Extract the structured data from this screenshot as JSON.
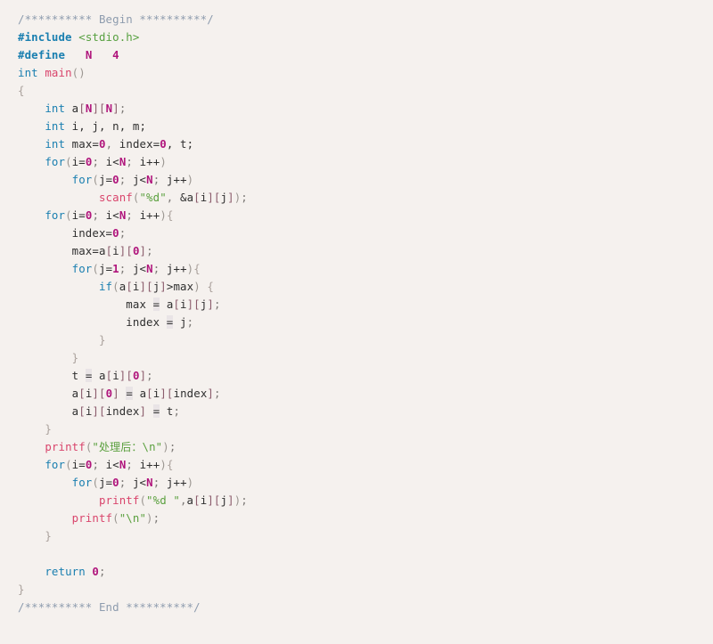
{
  "editor": {
    "language": "c",
    "background_color": "#f5f1ee",
    "default_text_color": "#2f2f2f",
    "font_size_px": 12.4,
    "line_height_px": 20,
    "total_lines": 35,
    "palette": {
      "comment": "#8e9cae",
      "preprocessor": "#1a7fb0",
      "header_name": "#57a040",
      "keyword": "#1a7fb0",
      "function": "#d9456c",
      "number": "#b0157c",
      "macro": "#b0157c",
      "string": "#5ba03f",
      "bracket": "#8c5d6d",
      "brace": "#aaa19c",
      "paren": "#9c9792",
      "operator_highlight_bg": "#e9e4e6"
    }
  },
  "code": {
    "lines": [
      {
        "n": 1,
        "text": "/********** Begin **********/"
      },
      {
        "n": 2,
        "text": "#include <stdio.h>"
      },
      {
        "n": 3,
        "text": "#define   N   4"
      },
      {
        "n": 4,
        "text": "int main()"
      },
      {
        "n": 5,
        "text": "{"
      },
      {
        "n": 6,
        "text": "    int a[N][N];"
      },
      {
        "n": 7,
        "text": "    int i, j, n, m;"
      },
      {
        "n": 8,
        "text": "    int max=0, index=0, t;"
      },
      {
        "n": 9,
        "text": "    for(i=0; i<N; i++)"
      },
      {
        "n": 10,
        "text": "        for(j=0; j<N; j++)"
      },
      {
        "n": 11,
        "text": "            scanf(\"%d\", &a[i][j]);"
      },
      {
        "n": 12,
        "text": "    for(i=0; i<N; i++){"
      },
      {
        "n": 13,
        "text": "        index=0;"
      },
      {
        "n": 14,
        "text": "        max=a[i][0];"
      },
      {
        "n": 15,
        "text": "        for(j=1; j<N; j++){"
      },
      {
        "n": 16,
        "text": "            if(a[i][j]>max) {"
      },
      {
        "n": 17,
        "text": "                max = a[i][j];"
      },
      {
        "n": 18,
        "text": "                index = j;"
      },
      {
        "n": 19,
        "text": "            }"
      },
      {
        "n": 20,
        "text": "        }"
      },
      {
        "n": 21,
        "text": "        t = a[i][0];"
      },
      {
        "n": 22,
        "text": "        a[i][0] = a[i][index];"
      },
      {
        "n": 23,
        "text": "        a[i][index] = t;"
      },
      {
        "n": 24,
        "text": "    }"
      },
      {
        "n": 25,
        "text": "    printf(\"处理后：\\n\");"
      },
      {
        "n": 26,
        "text": "    for(i=0; i<N; i++){"
      },
      {
        "n": 27,
        "text": "        for(j=0; j<N; j++)"
      },
      {
        "n": 28,
        "text": "            printf(\"%d \",a[i][j]);"
      },
      {
        "n": 29,
        "text": "        printf(\"\\n\");"
      },
      {
        "n": 30,
        "text": "    }"
      },
      {
        "n": 31,
        "text": ""
      },
      {
        "n": 32,
        "text": "    return 0;"
      },
      {
        "n": 33,
        "text": "}"
      },
      {
        "n": 34,
        "text": "/********** End **********/"
      }
    ]
  },
  "tokens": {
    "l1_comment": "/********** Begin **********/",
    "l2_include": "#include",
    "l2_header": "<stdio.h>",
    "l3_define": "#define",
    "l3_macro_name": "N",
    "l3_macro_value": "4",
    "l4_int": "int",
    "l4_main": "main",
    "l4_parens": "()",
    "l5_brace": "{",
    "l6_int": "int",
    "l6_a": "a",
    "l6_N1": "N",
    "l6_N2": "N",
    "l7_int": "int",
    "l7_vars": "i, j, n, m;",
    "l8_int": "int",
    "l8_max": "max",
    "l8_zero1": "0",
    "l8_index": "index",
    "l8_zero2": "0",
    "l8_t": ", t;",
    "l9_for": "for",
    "l9_i0": "0",
    "l9_N": "N",
    "l10_for": "for",
    "l10_j0": "0",
    "l10_N": "N",
    "l11_scanf": "scanf",
    "l11_fmt": "\"%d\"",
    "l12_for": "for",
    "l13_index": "index",
    "l13_zero": "0",
    "l14_max": "max",
    "l14_zero": "0",
    "l15_for": "for",
    "l15_one": "1",
    "l16_if": "if",
    "l17_max": "max",
    "l18_index": "index",
    "l21_t": "t",
    "l21_zero": "0",
    "l22_zero": "0",
    "l23_index": "index",
    "l25_printf": "printf",
    "l25_str_open": "\"",
    "l25_cjk": "处理后：",
    "l25_esc": "\\n",
    "l25_str_close": "\"",
    "l26_for": "for",
    "l27_for": "for",
    "l28_printf": "printf",
    "l28_fmt": "\"%d \"",
    "l29_printf": "printf",
    "l29_fmt": "\"\\n\"",
    "l32_return": "return",
    "l32_zero": "0",
    "l34_comment": "/********** End **********/"
  }
}
